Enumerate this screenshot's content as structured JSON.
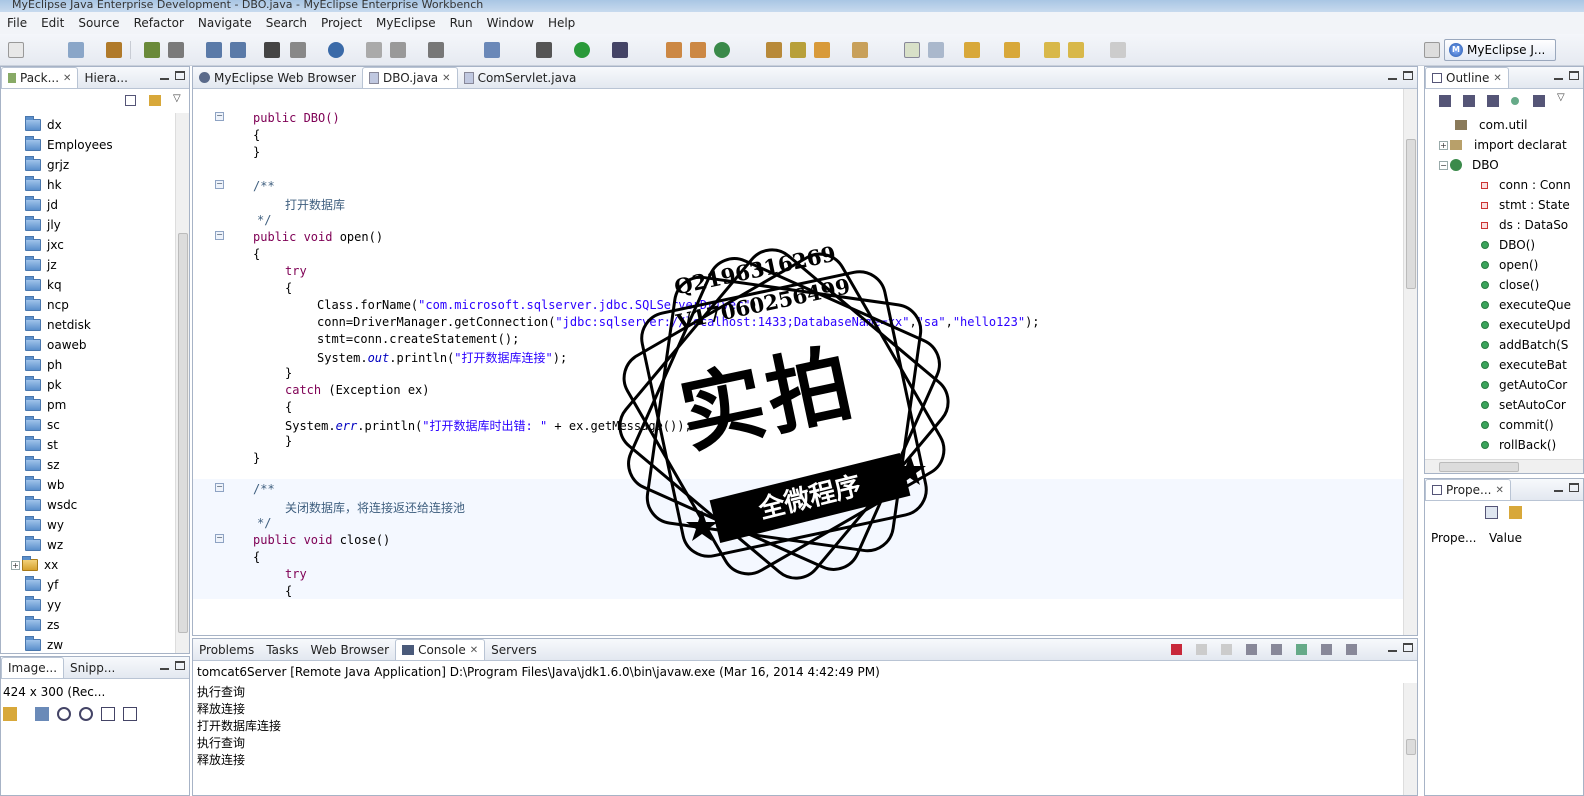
{
  "window": {
    "title": "MyEclipse Java Enterprise Development - DBO.java - MyEclipse Enterprise Workbench"
  },
  "menu": [
    "File",
    "Edit",
    "Source",
    "Refactor",
    "Navigate",
    "Search",
    "Project",
    "MyEclipse",
    "Run",
    "Window",
    "Help"
  ],
  "perspective": {
    "label": "MyEclipse J..."
  },
  "left_panel": {
    "tabs": [
      {
        "label": "Pack..."
      },
      {
        "label": "Hiera..."
      }
    ],
    "tree": [
      "dx",
      "Employees",
      "grjz",
      "hk",
      "jd",
      "jly",
      "jxc",
      "jz",
      "kq",
      "ncp",
      "netdisk",
      "oaweb",
      "ph",
      "pk",
      "pm",
      "sc",
      "st",
      "sz",
      "wb",
      "wsdc",
      "wy",
      "wz",
      "xx",
      "yf",
      "yy",
      "zs",
      "zw"
    ]
  },
  "image_panel": {
    "tabs": [
      {
        "label": "Image..."
      },
      {
        "label": "Snipp..."
      }
    ],
    "info": "424 x 300 (Rec..."
  },
  "editor": {
    "tabs": [
      {
        "label": "MyEclipse Web Browser"
      },
      {
        "label": "DBO.java"
      },
      {
        "label": "ComServlet.java"
      }
    ],
    "lines": {
      "l1": "public DBO()",
      "l2": "{",
      "l3": "}",
      "l4": "/**",
      "l5": "打开数据库",
      "l6": "*/",
      "l7a": "public void ",
      "l7b": "open()",
      "l8": "{",
      "l9": "try",
      "l10": "{",
      "l11a": "Class.forName(",
      "l11b": "\"com.microsoft.sqlserver.jdbc.SQLServerDriver\"",
      "l11c": ");",
      "l12a": "conn=DriverManager.getConnection(",
      "l12b": "\"jdbc:sqlserver://localhost:1433;DatabaseName=xx\"",
      "l12c": ",",
      "l12d": "\"sa\"",
      "l12e": ",",
      "l12f": "\"hello123\"",
      "l12g": ");",
      "l13": "stmt=conn.createStatement();",
      "l14a": "System.",
      "l14b": "out",
      "l14c": ".println(",
      "l14d": "\"打开数据库连接\"",
      "l14e": ");",
      "l15": "}",
      "l16a": "catch",
      "l16b": " (Exception ex)",
      "l17": "{",
      "l18a": "System.",
      "l18b": "err",
      "l18c": ".println(",
      "l18d": "\"打开数据库时出错: \"",
      "l18e": " + ex.getMessage());",
      "l19": "}",
      "l20": "}",
      "l21": "/**",
      "l22": "关闭数据库，将连接返还给连接池",
      "l23": "*/",
      "l24a": "public void ",
      "l24b": "close()",
      "l25": "{",
      "l26": "try",
      "l27": "{"
    }
  },
  "console": {
    "tabs": [
      {
        "label": "Problems"
      },
      {
        "label": "Tasks"
      },
      {
        "label": "Web Browser"
      },
      {
        "label": "Console"
      },
      {
        "label": "Servers"
      }
    ],
    "header": "tomcat6Server [Remote Java Application] D:\\Program Files\\Java\\jdk1.6.0\\bin\\javaw.exe (Mar 16, 2014 4:42:49 PM)",
    "lines": [
      "执行查询",
      "释放连接",
      "打开数据库连接",
      "执行查询",
      "释放连接"
    ]
  },
  "outline": {
    "tab": "Outline",
    "items": [
      {
        "label": "com.util",
        "kind": "package"
      },
      {
        "label": "import declarat",
        "kind": "imports"
      },
      {
        "label": "DBO",
        "kind": "class"
      },
      {
        "label": "conn : Conn",
        "kind": "field"
      },
      {
        "label": "stmt : State",
        "kind": "field"
      },
      {
        "label": "ds : DataSo",
        "kind": "field"
      },
      {
        "label": "DBO()",
        "kind": "method"
      },
      {
        "label": "open()",
        "kind": "method"
      },
      {
        "label": "close()",
        "kind": "method"
      },
      {
        "label": "executeQue",
        "kind": "method"
      },
      {
        "label": "executeUpd",
        "kind": "method"
      },
      {
        "label": "addBatch(S",
        "kind": "method"
      },
      {
        "label": "executeBat",
        "kind": "method"
      },
      {
        "label": "getAutoCor",
        "kind": "method"
      },
      {
        "label": "setAutoCor",
        "kind": "method"
      },
      {
        "label": "commit()",
        "kind": "method"
      },
      {
        "label": "rollBack()",
        "kind": "method"
      }
    ]
  },
  "properties": {
    "tab": "Prope...",
    "col_property": "Prope...",
    "col_value": "Value"
  },
  "watermark": {
    "line1": "Q2196316269",
    "line2": "V17060256499",
    "big": "实拍",
    "band": "全微程序"
  }
}
